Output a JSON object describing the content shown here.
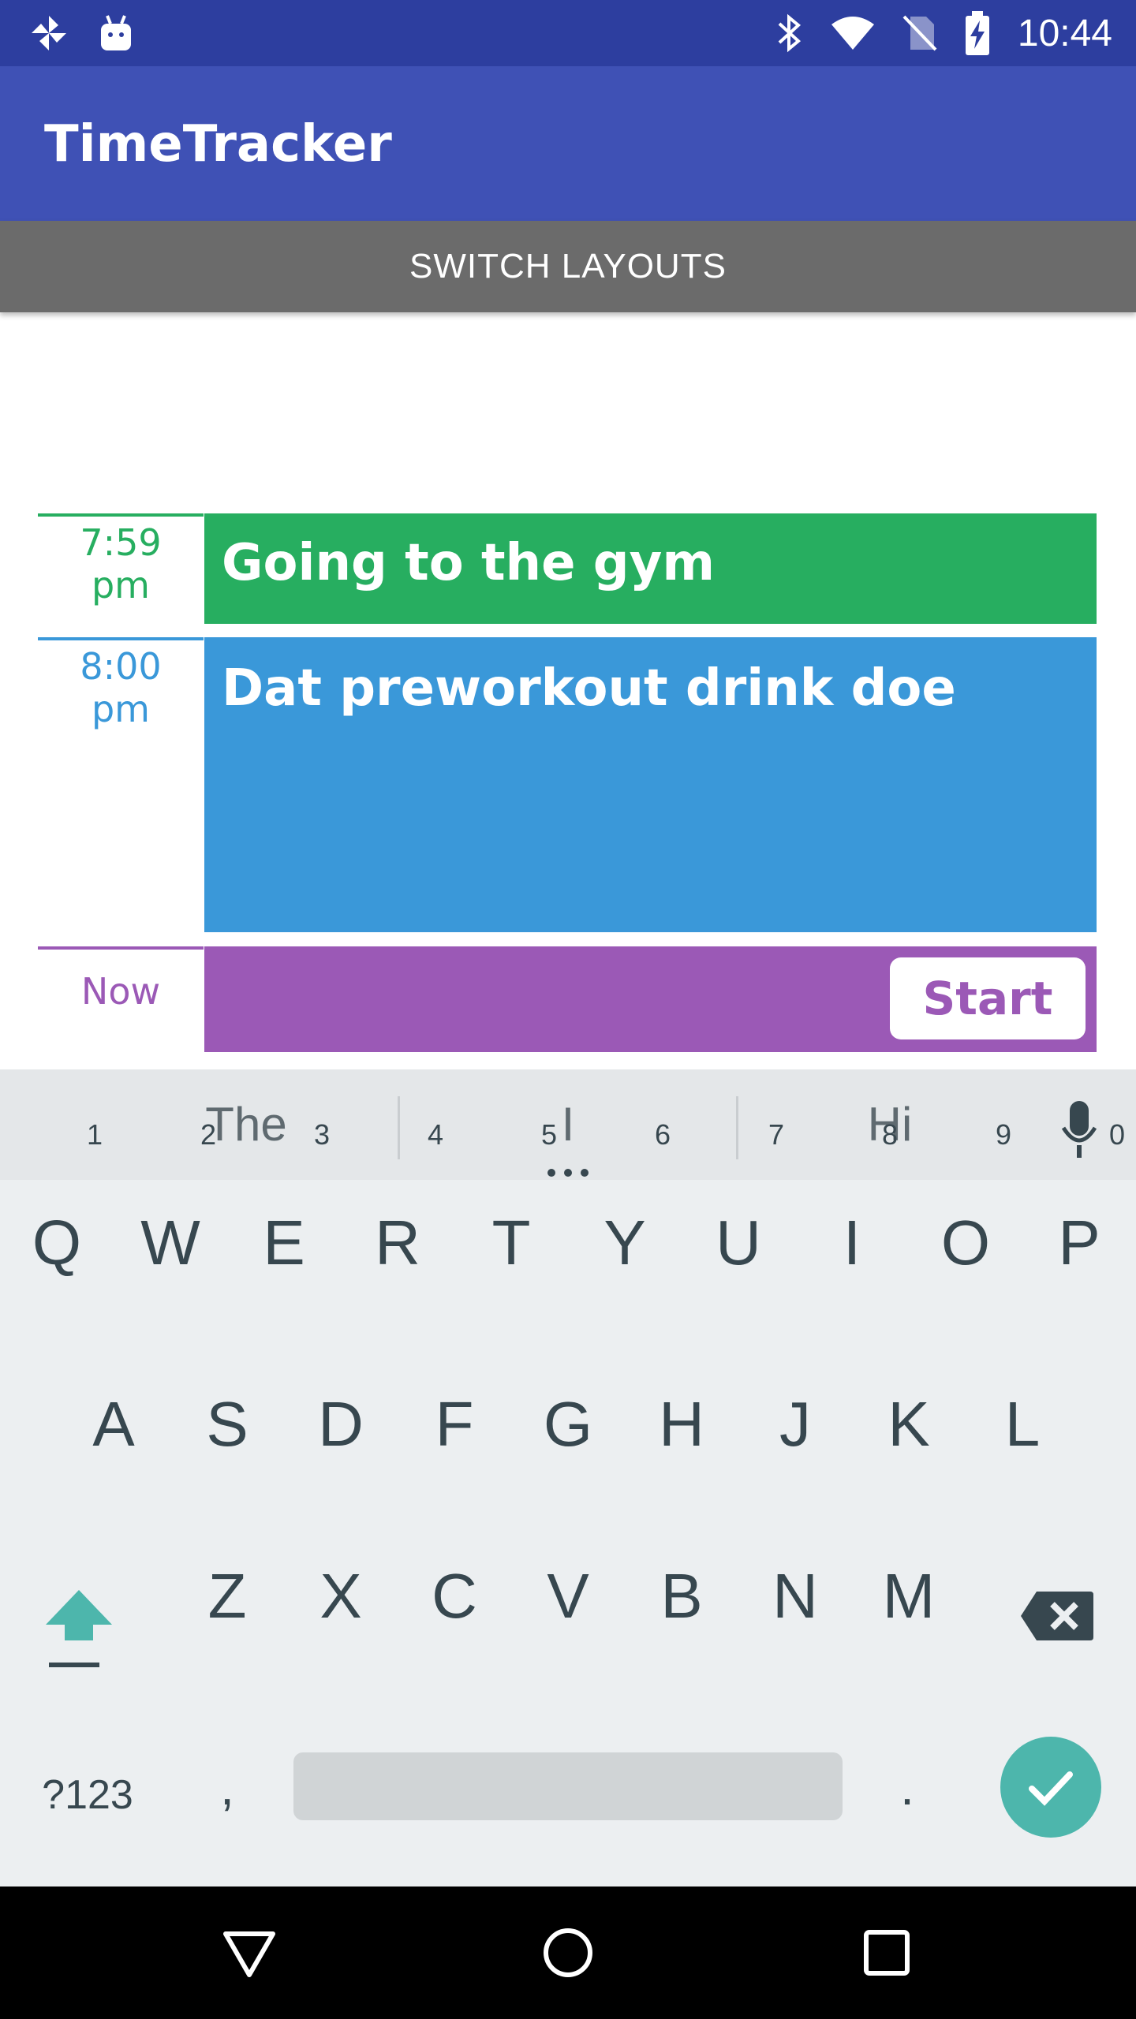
{
  "status_bar": {
    "time": "10:44",
    "left_icons": [
      "pinwheel-icon",
      "android-icon"
    ],
    "right_icons": [
      "bluetooth-icon",
      "wifi-icon",
      "no-sim-icon",
      "battery-charging-icon"
    ]
  },
  "app_bar": {
    "title": "TimeTracker"
  },
  "switch_button": {
    "label": "SWITCH LAYOUTS"
  },
  "entries": [
    {
      "time_line1": "7:59",
      "time_line2": "pm",
      "title": "Going to the gym",
      "color": "#27ae60"
    },
    {
      "time_line1": "8:00",
      "time_line2": "pm",
      "title": "Dat preworkout drink doe",
      "color": "#3a98d9"
    },
    {
      "time_label": "Now",
      "start_label": "Start",
      "color": "#9b59b6"
    }
  ],
  "keyboard": {
    "suggestions": [
      "The",
      "I",
      "Hi"
    ],
    "row1": [
      {
        "key": "Q",
        "hint": "1"
      },
      {
        "key": "W",
        "hint": "2"
      },
      {
        "key": "E",
        "hint": "3"
      },
      {
        "key": "R",
        "hint": "4"
      },
      {
        "key": "T",
        "hint": "5"
      },
      {
        "key": "Y",
        "hint": "6"
      },
      {
        "key": "U",
        "hint": "7"
      },
      {
        "key": "I",
        "hint": "8"
      },
      {
        "key": "O",
        "hint": "9"
      },
      {
        "key": "P",
        "hint": "0"
      }
    ],
    "row2": [
      "A",
      "S",
      "D",
      "F",
      "G",
      "H",
      "J",
      "K",
      "L"
    ],
    "row3": [
      "Z",
      "X",
      "C",
      "V",
      "B",
      "N",
      "M"
    ],
    "symbols_label": "?123",
    "comma": ",",
    "period": ".",
    "accent_color": "#4db6ac"
  },
  "nav_bar": {
    "buttons": [
      "back-icon",
      "home-icon",
      "recents-icon"
    ]
  }
}
